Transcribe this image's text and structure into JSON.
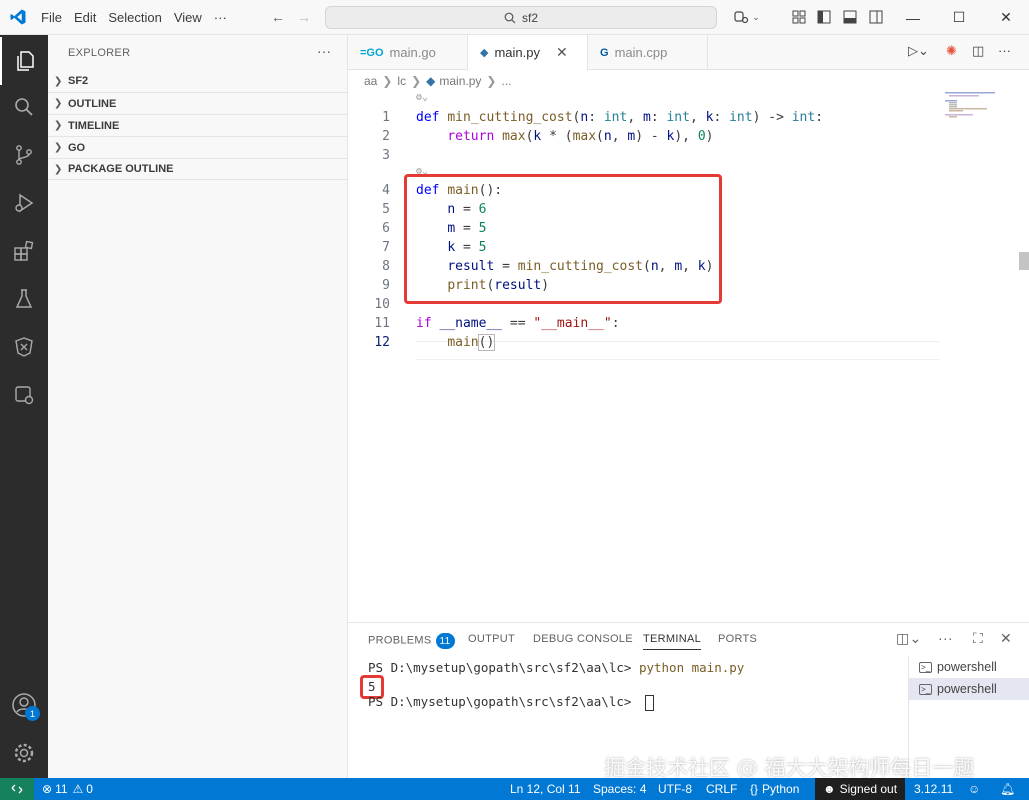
{
  "menu": {
    "file": "File",
    "edit": "Edit",
    "selection": "Selection",
    "view": "View",
    "more": "···"
  },
  "search": {
    "text": "sf2"
  },
  "sidebar": {
    "title": "EXPLORER",
    "sections": [
      "SF2",
      "OUTLINE",
      "TIMELINE",
      "GO",
      "PACKAGE OUTLINE"
    ]
  },
  "tabs": [
    {
      "label": "main.go",
      "icon": "go-file-icon"
    },
    {
      "label": "main.py",
      "icon": "python-file-icon"
    },
    {
      "label": "main.cpp",
      "icon": "cpp-file-icon"
    }
  ],
  "breadcrumb": [
    "aa",
    "lc",
    "main.py",
    "..."
  ],
  "code_lines": [
    {
      "n": "1"
    },
    {
      "n": "2"
    },
    {
      "n": "3"
    },
    {
      "n": "4"
    },
    {
      "n": "5"
    },
    {
      "n": "6"
    },
    {
      "n": "7"
    },
    {
      "n": "8"
    },
    {
      "n": "9"
    },
    {
      "n": "10"
    },
    {
      "n": "11"
    },
    {
      "n": "12"
    }
  ],
  "code": {
    "l1": [
      "def",
      " ",
      "min_cutting_cost",
      "(",
      "n",
      ": ",
      "int",
      ", ",
      "m",
      ": ",
      "int",
      ", ",
      "k",
      ": ",
      "int",
      ") -> ",
      "int",
      ":"
    ],
    "l2": [
      "    ",
      "return",
      " ",
      "max",
      "(",
      "k",
      " * (",
      "max",
      "(",
      "n",
      ", ",
      "m",
      ") - ",
      "k",
      "), ",
      "0",
      ")"
    ],
    "l4": [
      "def",
      " ",
      "main",
      "():"
    ],
    "l5": [
      "    ",
      "n",
      " = ",
      "6"
    ],
    "l6": [
      "    ",
      "m",
      " = ",
      "5"
    ],
    "l7": [
      "    ",
      "k",
      " = ",
      "5"
    ],
    "l8": [
      "    ",
      "result",
      " = ",
      "min_cutting_cost",
      "(",
      "n",
      ", ",
      "m",
      ", ",
      "k",
      ")"
    ],
    "l9": [
      "    ",
      "print",
      "(",
      "result",
      ")"
    ],
    "l11": [
      "if",
      " ",
      "__name__",
      " == ",
      "\"__main__\"",
      ":"
    ],
    "l12": [
      "    ",
      "main",
      "()"
    ]
  },
  "panel": {
    "tabs": [
      "PROBLEMS",
      "OUTPUT",
      "DEBUG CONSOLE",
      "TERMINAL",
      "PORTS"
    ],
    "problems_count": "11",
    "terminal": {
      "prompt1": "PS D:\\mysetup\\gopath\\src\\sf2\\aa\\lc> ",
      "cmd1": "python main.py",
      "output": "5",
      "prompt2": "PS D:\\mysetup\\gopath\\src\\sf2\\aa\\lc> "
    },
    "terminal_list": [
      "powershell",
      "powershell"
    ]
  },
  "watermark": "掘金技术社区 @ 福大大架构师每日一题",
  "status": {
    "errors": "11",
    "warnings": "0",
    "position": "Ln 12, Col 11",
    "spaces": "Spaces: 4",
    "encoding": "UTF-8",
    "eol": "CRLF",
    "language": "Python",
    "account": "Signed out",
    "python_version": "3.12.11"
  },
  "accounts_badge": "1",
  "colors": {
    "accent": "#0078d4",
    "highlight_box": "#e53935",
    "remote": "#16825d"
  }
}
